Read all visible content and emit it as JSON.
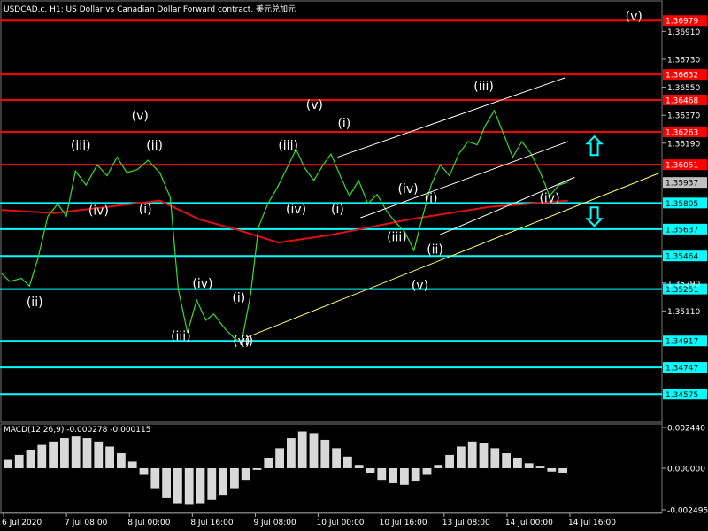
{
  "header": {
    "title": "USDCAD.c, H1:  US Dollar vs Canadian Dollar Forward contract, 美元兑加元"
  },
  "macd": {
    "label": "MACD(12,26,9) -0.000278 -0.000115",
    "axis": [
      {
        "label": "0.002440",
        "value": 0.00244
      },
      {
        "label": "0.000000",
        "value": 0.0
      },
      {
        "label": "-0.002495",
        "value": -0.002495
      }
    ]
  },
  "chart_data": {
    "type": "line",
    "symbol": "USDCAD.c",
    "timeframe": "H1",
    "ylim": [
      1.344,
      1.371
    ],
    "price_levels": [
      {
        "label": "1.36979",
        "value": 1.36979,
        "color": "#ff0000"
      },
      {
        "label": "1.36632",
        "value": 1.36632,
        "color": "#ff0000"
      },
      {
        "label": "1.36468",
        "value": 1.36468,
        "color": "#ff0000"
      },
      {
        "label": "1.36263",
        "value": 1.36263,
        "color": "#ff0000"
      },
      {
        "label": "1.36051",
        "value": 1.36051,
        "color": "#ff0000"
      },
      {
        "label": "1.35805",
        "value": 1.35805,
        "color": "#00ffff"
      },
      {
        "label": "1.35637",
        "value": 1.35637,
        "color": "#00ffff"
      },
      {
        "label": "1.35464",
        "value": 1.35464,
        "color": "#00ffff"
      },
      {
        "label": "1.35251",
        "value": 1.35251,
        "color": "#00ffff"
      },
      {
        "label": "1.34917",
        "value": 1.34917,
        "color": "#00ffff"
      },
      {
        "label": "1.34747",
        "value": 1.34747,
        "color": "#00ffff"
      },
      {
        "label": "1.34575",
        "value": 1.34575,
        "color": "#00ffff"
      }
    ],
    "y_ticks": [
      {
        "label": "1.36910",
        "value": 1.3691
      },
      {
        "label": "1.36730",
        "value": 1.3673
      },
      {
        "label": "1.36550",
        "value": 1.3655
      },
      {
        "label": "1.36370",
        "value": 1.3637
      },
      {
        "label": "1.36190",
        "value": 1.3619
      },
      {
        "label": "1.35290",
        "value": 1.3529
      },
      {
        "label": "1.35110",
        "value": 1.3511
      }
    ],
    "current_price": {
      "label": "1.35937",
      "value": 1.35937
    },
    "x_ticks": [
      "6 Jul 2020",
      "7 Jul 08:00",
      "8 Jul 00:00",
      "8 Jul 16:00",
      "9 Jul 08:00",
      "10 Jul 00:00",
      "10 Jul 16:00",
      "13 Jul 08:00",
      "14 Jul 00:00",
      "14 Jul 16:00"
    ],
    "price_path": [
      [
        0,
        1.3535
      ],
      [
        0.012,
        1.353
      ],
      [
        0.03,
        1.3532
      ],
      [
        0.042,
        1.3527
      ],
      [
        0.055,
        1.3545
      ],
      [
        0.07,
        1.3572
      ],
      [
        0.085,
        1.358
      ],
      [
        0.098,
        1.3572
      ],
      [
        0.112,
        1.3601
      ],
      [
        0.128,
        1.3592
      ],
      [
        0.145,
        1.3605
      ],
      [
        0.16,
        1.3598
      ],
      [
        0.175,
        1.361
      ],
      [
        0.19,
        1.36
      ],
      [
        0.206,
        1.3602
      ],
      [
        0.222,
        1.3608
      ],
      [
        0.24,
        1.36
      ],
      [
        0.256,
        1.3584
      ],
      [
        0.268,
        1.3525
      ],
      [
        0.282,
        1.3497
      ],
      [
        0.296,
        1.3518
      ],
      [
        0.31,
        1.3505
      ],
      [
        0.322,
        1.3509
      ],
      [
        0.338,
        1.35
      ],
      [
        0.352,
        1.3494
      ],
      [
        0.364,
        1.349
      ],
      [
        0.378,
        1.3522
      ],
      [
        0.39,
        1.3565
      ],
      [
        0.404,
        1.358
      ],
      [
        0.418,
        1.359
      ],
      [
        0.432,
        1.3602
      ],
      [
        0.447,
        1.3615
      ],
      [
        0.46,
        1.3603
      ],
      [
        0.474,
        1.3595
      ],
      [
        0.488,
        1.3605
      ],
      [
        0.5,
        1.3612
      ],
      [
        0.514,
        1.3598
      ],
      [
        0.528,
        1.3585
      ],
      [
        0.542,
        1.3595
      ],
      [
        0.556,
        1.358
      ],
      [
        0.57,
        1.3586
      ],
      [
        0.585,
        1.3575
      ],
      [
        0.598,
        1.3568
      ],
      [
        0.612,
        1.3562
      ],
      [
        0.626,
        1.355
      ],
      [
        0.638,
        1.357
      ],
      [
        0.652,
        1.3592
      ],
      [
        0.666,
        1.3605
      ],
      [
        0.68,
        1.3598
      ],
      [
        0.694,
        1.3612
      ],
      [
        0.708,
        1.362
      ],
      [
        0.722,
        1.3618
      ],
      [
        0.734,
        1.363
      ],
      [
        0.748,
        1.364
      ],
      [
        0.762,
        1.3625
      ],
      [
        0.776,
        1.361
      ],
      [
        0.79,
        1.362
      ],
      [
        0.804,
        1.3612
      ],
      [
        0.818,
        1.36
      ],
      [
        0.832,
        1.3585
      ],
      [
        0.846,
        1.3592
      ],
      [
        0.86,
        1.3594
      ]
    ],
    "wave_labels": [
      {
        "text": "(v)",
        "t": 0.96,
        "price": 1.3698
      },
      {
        "text": "(iii)",
        "t": 0.732,
        "price": 1.3653
      },
      {
        "text": "(v)",
        "t": 0.475,
        "price": 1.3641
      },
      {
        "text": "(v)",
        "t": 0.21,
        "price": 1.3634
      },
      {
        "text": "(i)",
        "t": 0.52,
        "price": 1.3629
      },
      {
        "text": "(iii)",
        "t": 0.12,
        "price": 1.3615
      },
      {
        "text": "(ii)",
        "t": 0.232,
        "price": 1.3615
      },
      {
        "text": "(iii)",
        "t": 0.435,
        "price": 1.3615
      },
      {
        "text": "(iv)",
        "t": 0.617,
        "price": 1.3587
      },
      {
        "text": "(i)",
        "t": 0.652,
        "price": 1.3581
      },
      {
        "text": "(iv)",
        "t": 0.832,
        "price": 1.3581
      },
      {
        "text": "(iv)",
        "t": 0.147,
        "price": 1.3573
      },
      {
        "text": "(i)",
        "t": 0.218,
        "price": 1.3574
      },
      {
        "text": "(iv)",
        "t": 0.447,
        "price": 1.3574
      },
      {
        "text": "(i)",
        "t": 0.51,
        "price": 1.3574
      },
      {
        "text": "(iii)",
        "t": 0.6,
        "price": 1.3556
      },
      {
        "text": "(ii)",
        "t": 0.658,
        "price": 1.3548
      },
      {
        "text": "(ii)",
        "t": 0.05,
        "price": 1.3514
      },
      {
        "text": "(iv)",
        "t": 0.305,
        "price": 1.3526
      },
      {
        "text": "(v)",
        "t": 0.635,
        "price": 1.3525
      },
      {
        "text": "(i)",
        "t": 0.36,
        "price": 1.3517
      },
      {
        "text": "(iii)",
        "t": 0.272,
        "price": 1.3492
      },
      {
        "text": "(v)",
        "t": 0.364,
        "price": 1.3489
      },
      {
        "text": "(i)",
        "t": 0.372,
        "price": 1.3489
      }
    ],
    "channel_lines": [
      {
        "from": [
          0.51,
          1.361
        ],
        "to": [
          0.855,
          1.3661
        ],
        "color": "#ffffff"
      },
      {
        "from": [
          0.545,
          1.3571
        ],
        "to": [
          0.86,
          1.362
        ],
        "color": "#ffffff"
      },
      {
        "from": [
          0.665,
          1.356
        ],
        "to": [
          0.87,
          1.3597
        ],
        "color": "#ffffff"
      },
      {
        "from": [
          0.372,
          1.3494
        ],
        "to": [
          1.0,
          1.36
        ],
        "color": "#ffff66"
      }
    ],
    "signals": [
      {
        "dir": "up",
        "t": 0.9,
        "price": 1.3617,
        "color": "#00ffff"
      },
      {
        "dir": "down",
        "t": 0.9,
        "price": 1.3572,
        "color": "#00ffff"
      }
    ],
    "ma_red": [
      [
        0,
        1.3576
      ],
      [
        0.08,
        1.3574
      ],
      [
        0.16,
        1.3578
      ],
      [
        0.24,
        1.3582
      ],
      [
        0.3,
        1.357
      ],
      [
        0.36,
        1.3563
      ],
      [
        0.42,
        1.3555
      ],
      [
        0.5,
        1.356
      ],
      [
        0.56,
        1.3565
      ],
      [
        0.62,
        1.357
      ],
      [
        0.68,
        1.3574
      ],
      [
        0.74,
        1.3578
      ],
      [
        0.8,
        1.358
      ],
      [
        0.86,
        1.3582
      ]
    ],
    "macd_histogram": [
      0.0005,
      0.0008,
      0.0011,
      0.0014,
      0.0016,
      0.0018,
      0.0019,
      0.0018,
      0.0016,
      0.0013,
      0.0009,
      0.0004,
      -0.0004,
      -0.0012,
      -0.0018,
      -0.0021,
      -0.0022,
      -0.0021,
      -0.0019,
      -0.0016,
      -0.0012,
      -0.0007,
      -0.0001,
      0.0006,
      0.0012,
      0.0018,
      0.0022,
      0.0021,
      0.0017,
      0.0012,
      0.0007,
      0.0002,
      -0.0003,
      -0.0007,
      -0.0009,
      -0.001,
      -0.0008,
      -0.0004,
      0.0002,
      0.0008,
      0.0013,
      0.0016,
      0.0015,
      0.0012,
      0.0009,
      0.0006,
      0.0003,
      0.0001,
      -0.0002,
      -0.0003
    ]
  }
}
